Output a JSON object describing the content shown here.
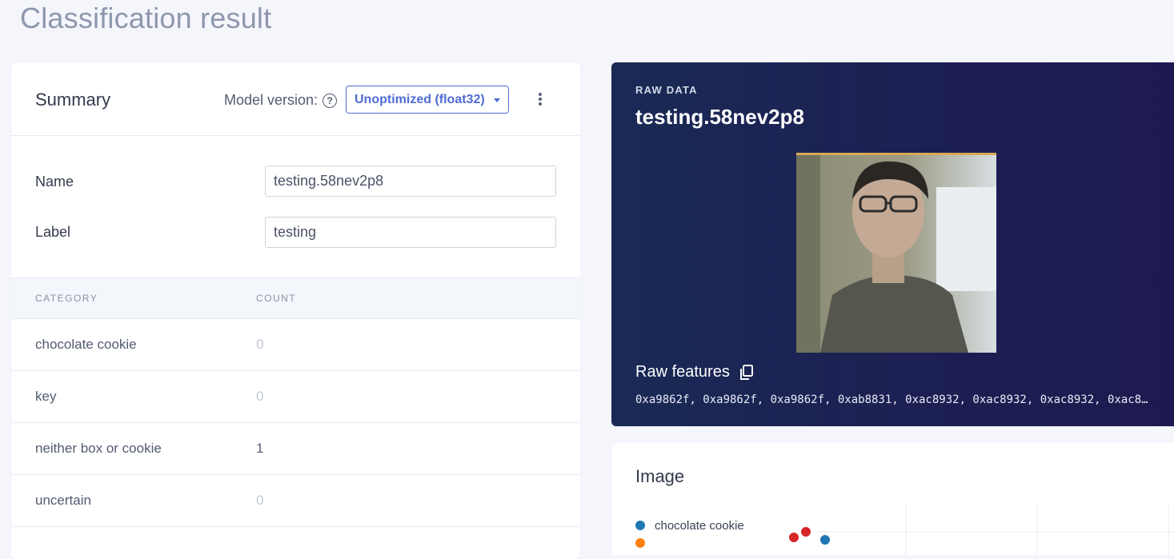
{
  "page": {
    "title": "Classification result"
  },
  "summary": {
    "title": "Summary",
    "model_version_label": "Model version:",
    "model_version_value": "Unoptimized (float32)",
    "fields": {
      "name_label": "Name",
      "name_value": "testing.58nev2p8",
      "label_label": "Label",
      "label_value": "testing"
    },
    "table": {
      "headers": [
        "CATEGORY",
        "COUNT"
      ],
      "rows": [
        {
          "category": "chocolate cookie",
          "count": "0"
        },
        {
          "category": "key",
          "count": "0"
        },
        {
          "category": "neither box or cookie",
          "count": "1"
        },
        {
          "category": "uncertain",
          "count": "0"
        }
      ]
    }
  },
  "raw_data": {
    "eyebrow": "RAW DATA",
    "title": "testing.58nev2p8",
    "features_label": "Raw features",
    "features_value": "0xa9862f, 0xa9862f, 0xa9862f, 0xab8831, 0xac8932, 0xac8932, 0xac8932, 0xac893…"
  },
  "image_panel": {
    "title": "Image",
    "legend": [
      {
        "label": "chocolate cookie",
        "color": "#1f77b4"
      },
      {
        "label": "",
        "color": "#ff7f0e"
      }
    ]
  },
  "colors": {
    "accent": "#4f6bd4",
    "raw_bg": "#1c1f52"
  },
  "icons": [
    "help-icon",
    "chevron-down-icon",
    "more-vertical-icon",
    "copy-icon"
  ]
}
